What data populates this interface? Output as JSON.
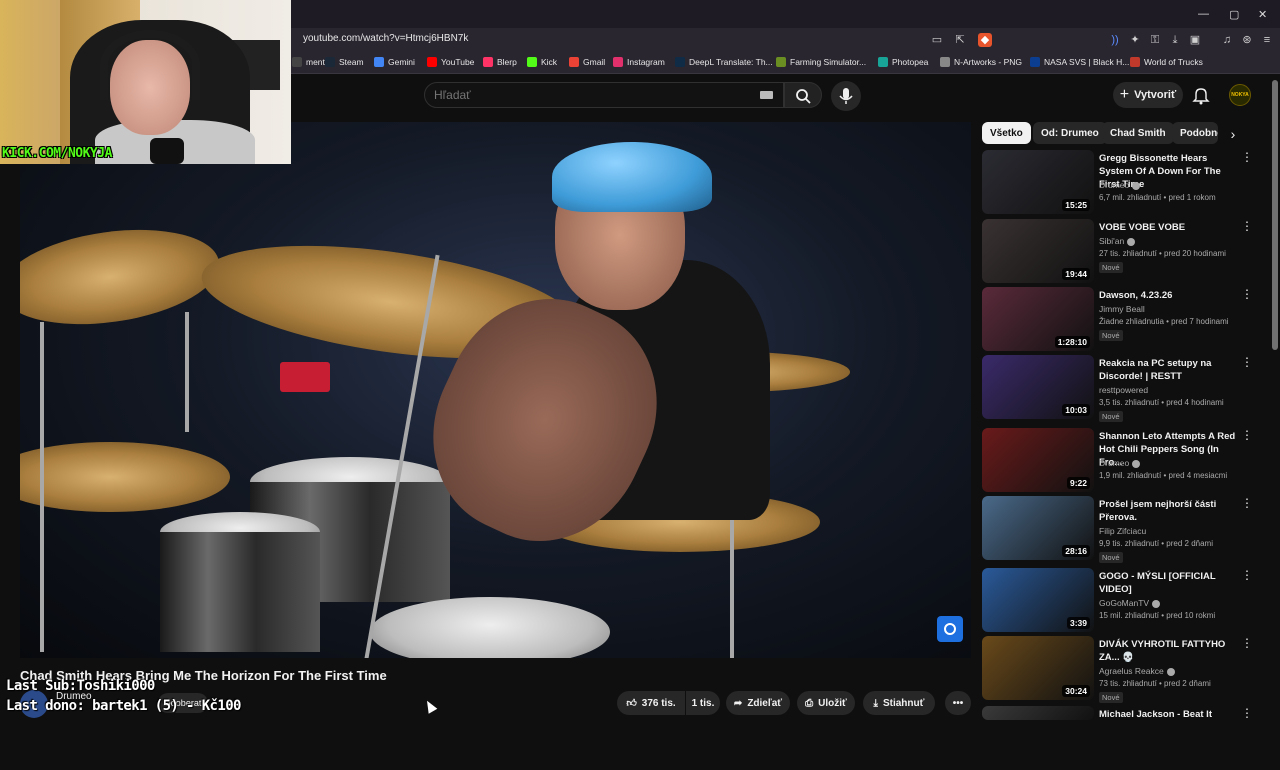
{
  "browser": {
    "url": "youtube.com/watch?v=Htmcj6HBN7k",
    "window_controls": [
      "—",
      "▢",
      "✕"
    ],
    "bookmarks": [
      {
        "label": "ments",
        "color": "#444444"
      },
      {
        "label": "Steam",
        "color": "#1b2838"
      },
      {
        "label": "Gemini",
        "color": "#4285f4"
      },
      {
        "label": "YouTube",
        "color": "#ff0000"
      },
      {
        "label": "Blerp",
        "color": "#ff3366"
      },
      {
        "label": "Kick",
        "color": "#53fc18"
      },
      {
        "label": "Gmail",
        "color": "#ea4335"
      },
      {
        "label": "Instagram",
        "color": "#e1306c"
      },
      {
        "label": "DeepL Translate: Th...",
        "color": "#0f2b46"
      },
      {
        "label": "Farming Simulator...",
        "color": "#6b8e23"
      },
      {
        "label": "Photopea",
        "color": "#18a497"
      },
      {
        "label": "N-Artworks - PNG",
        "color": "#888888"
      },
      {
        "label": "NASA SVS | Black H...",
        "color": "#0b3d91"
      },
      {
        "label": "World of Trucks",
        "color": "#c0392b"
      }
    ]
  },
  "header": {
    "search_placeholder": "Hľadať",
    "create_label": "Vytvoriť",
    "avatar_text": "NOKYA"
  },
  "webcam": {
    "kick_label": "KICK.COM/NOKYJA"
  },
  "video": {
    "title": "Chad Smith Hears Bring Me The Horizon For The First Time",
    "channel": "Drumeo",
    "subscribe_label": "Odoberať",
    "likes": "376 tis.",
    "dislikes": "1 tis.",
    "share": "Zdieľať",
    "save": "Uložiť",
    "download": "Stiahnuť",
    "more": "•••"
  },
  "stream_overlay": {
    "last_sub": "Last Sub:Toshiki000",
    "last_dono": "Last dono: bartek1 (5)  - Kč100"
  },
  "chips": [
    {
      "label": "Všetko",
      "active": true
    },
    {
      "label": "Od: Drumeo",
      "active": false
    },
    {
      "label": "Chad Smith",
      "active": false
    },
    {
      "label": "Podobné",
      "active": false
    }
  ],
  "recommendations": [
    {
      "title": "Gregg Bissonette Hears System Of A Down For The First Time",
      "channel": "Drumeo",
      "verified": true,
      "meta": "6,7 mil. zhliadnutí • pred 1 rokom",
      "duration": "15:25",
      "new": "",
      "thumb_color": "#2b2b33"
    },
    {
      "title": "VOBE VOBE VOBE",
      "channel": "Sibi'an",
      "verified": true,
      "meta": "27 tis. zhliadnutí • pred 20 hodinami",
      "duration": "19:44",
      "new": "Nové",
      "thumb_color": "#3a3232"
    },
    {
      "title": "Dawson, 4.23.26",
      "channel": "Jimmy Beall",
      "verified": false,
      "meta": "Žiadne zhliadnutia • pred 7 hodinami",
      "duration": "1:28:10",
      "new": "Nové",
      "thumb_color": "#5a2a3a"
    },
    {
      "title": "Reakcia na PC setupy na Discorde! | RESTT",
      "channel": "resttpowered",
      "verified": false,
      "meta": "3,5 tis. zhliadnutí • pred 4 hodinami",
      "duration": "10:03",
      "new": "Nové",
      "thumb_color": "#3a2a6a"
    },
    {
      "title": "Shannon Leto Attempts A Red Hot Chili Peppers Song (In Fro...",
      "channel": "Drumeo",
      "verified": true,
      "meta": "1,9 mil. zhliadnutí • pred 4 mesiacmi",
      "duration": "9:22",
      "new": "",
      "thumb_color": "#6a1a1a"
    },
    {
      "title": "Prošel jsem nejhorší části Přerova.",
      "channel": "Filip Zifciacu",
      "verified": false,
      "meta": "9,9 tis. zhliadnutí • pred 2 dňami",
      "duration": "28:16",
      "new": "Nové",
      "thumb_color": "#4a6a8a"
    },
    {
      "title": "GOGO - MÝSLI [OFFICIAL VIDEO]",
      "channel": "GoGoManTV",
      "verified": true,
      "meta": "15 mil. zhliadnutí • pred 10 rokmi",
      "duration": "3:39",
      "new": "",
      "thumb_color": "#2a5a9a"
    },
    {
      "title": "DIVÁK VYHROTIL FATTYHO ZA... 💀",
      "channel": "Agraelus Reakce",
      "verified": true,
      "meta": "73 tis. zhliadnutí • pred 2 dňami",
      "duration": "30:24",
      "new": "Nové",
      "thumb_color": "#6a4a1a"
    },
    {
      "title": "Michael Jackson - Beat It",
      "channel": "",
      "verified": false,
      "meta": "",
      "duration": "",
      "new": "",
      "thumb_color": "#3a3a3a"
    }
  ]
}
